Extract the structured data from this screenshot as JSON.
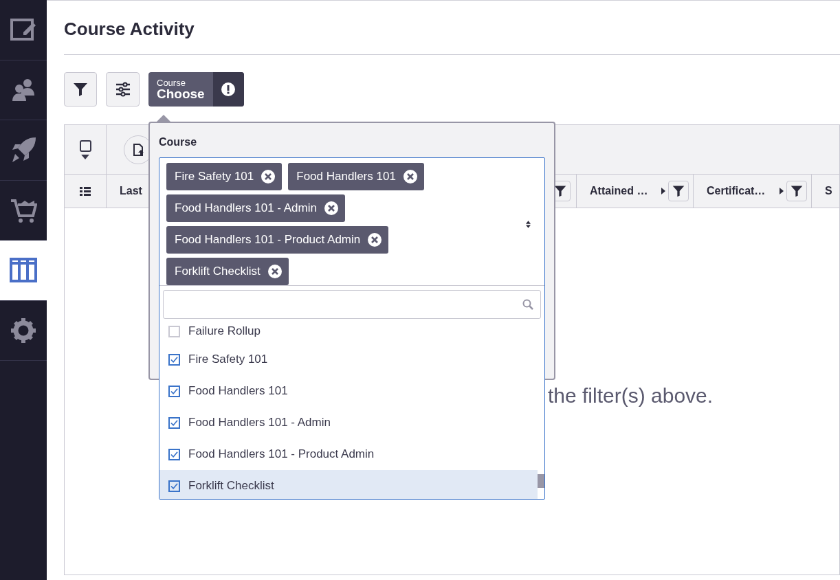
{
  "sidebar": {
    "items": [
      {
        "kind": "edit",
        "selected": false
      },
      {
        "kind": "users",
        "selected": false
      },
      {
        "kind": "rocket",
        "selected": false
      },
      {
        "kind": "cart",
        "selected": false
      },
      {
        "kind": "columns",
        "selected": true
      },
      {
        "kind": "gear",
        "selected": false
      }
    ]
  },
  "page": {
    "title": "Course Activity"
  },
  "toolbar": {
    "course_filter": {
      "label": "Course",
      "value": "Choose"
    }
  },
  "table": {
    "select_all_checked": false,
    "columns": [
      {
        "label": "Last",
        "kind": "plain"
      },
      {
        "kind": "filter"
      },
      {
        "label": "Attained …",
        "kind": "caret_filter"
      },
      {
        "label": "Certificat…",
        "kind": "caret_filter"
      },
      {
        "label": "S",
        "kind": "plain"
      }
    ],
    "empty_message": "the filter(s) above."
  },
  "course_popover": {
    "label": "Course",
    "chips": [
      "Fire Safety 101",
      "Food Handlers 101",
      "Food Handlers 101 - Admin",
      "Food Handlers 101 - Product Admin",
      "Forklift Checklist"
    ],
    "options": [
      {
        "label": "Failure Rollup",
        "checked": false,
        "selected": false
      },
      {
        "label": "Fire Safety 101",
        "checked": true,
        "selected": false
      },
      {
        "label": "Food Handlers 101",
        "checked": true,
        "selected": false
      },
      {
        "label": "Food Handlers 101 - Admin",
        "checked": true,
        "selected": false
      },
      {
        "label": "Food Handlers 101 - Product Admin",
        "checked": true,
        "selected": false
      },
      {
        "label": "Forklift Checklist",
        "checked": true,
        "selected": true
      }
    ]
  }
}
